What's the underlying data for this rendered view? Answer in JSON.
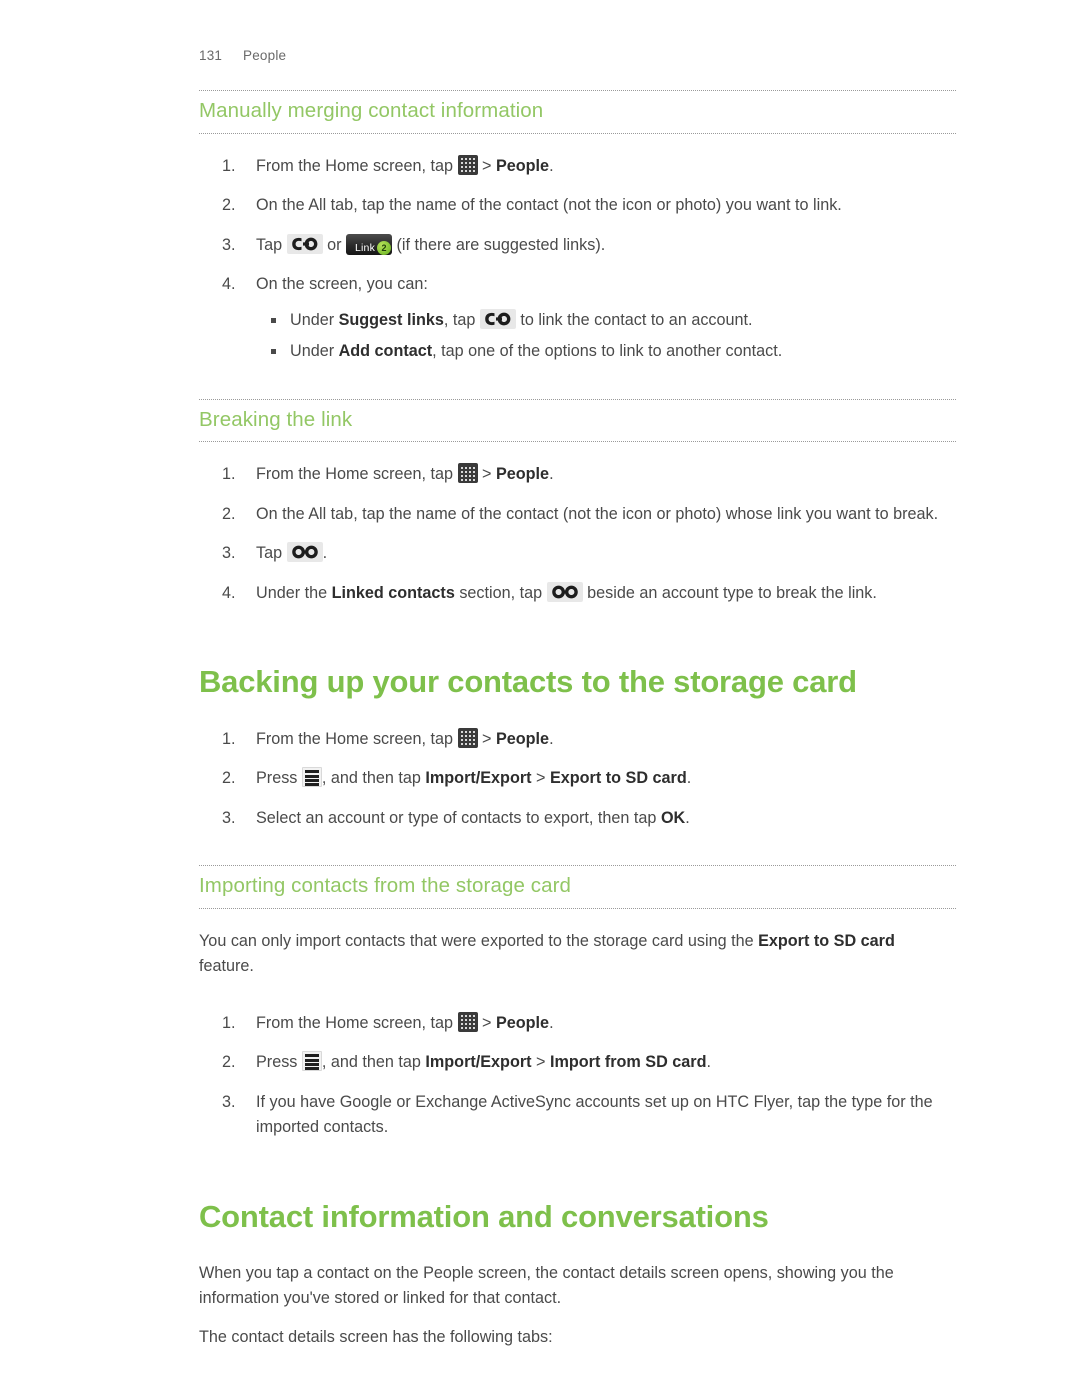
{
  "header": {
    "page_number": "131",
    "section": "People"
  },
  "colors": {
    "heading_h1": "#7ec04b",
    "heading_h2": "#93c765",
    "body_text": "#4a4a4a",
    "rule": "#9a9a9a",
    "badge_green": "#7cbf2f"
  },
  "sections": [
    {
      "id": "manually-merging",
      "level": "h2",
      "title": "Manually merging contact information",
      "steps": [
        {
          "parts": [
            {
              "t": "text",
              "v": "From the Home screen, tap "
            },
            {
              "t": "icon",
              "v": "apps-grid-icon"
            },
            {
              "t": "text",
              "v": " > "
            },
            {
              "t": "bold",
              "v": "People"
            },
            {
              "t": "text",
              "v": "."
            }
          ]
        },
        {
          "parts": [
            {
              "t": "text",
              "v": "On the All tab, tap the name of the contact (not the icon or photo) you want to link."
            }
          ]
        },
        {
          "parts": [
            {
              "t": "text",
              "v": "Tap "
            },
            {
              "t": "icon",
              "v": "link-chain-icon"
            },
            {
              "t": "text",
              "v": " or "
            },
            {
              "t": "icon",
              "v": "link-button-badge-icon"
            },
            {
              "t": "text",
              "v": " (if there are suggested links)."
            }
          ]
        },
        {
          "parts": [
            {
              "t": "text",
              "v": "On the screen, you can:"
            }
          ],
          "bullets": [
            [
              {
                "t": "text",
                "v": "Under "
              },
              {
                "t": "bold",
                "v": "Suggest links"
              },
              {
                "t": "text",
                "v": ", tap "
              },
              {
                "t": "icon",
                "v": "link-chain-icon"
              },
              {
                "t": "text",
                "v": " to link the contact to an account."
              }
            ],
            [
              {
                "t": "text",
                "v": "Under "
              },
              {
                "t": "bold",
                "v": "Add contact"
              },
              {
                "t": "text",
                "v": ", tap one of the options to link to another contact."
              }
            ]
          ]
        }
      ]
    },
    {
      "id": "breaking-the-link",
      "level": "h2",
      "title": "Breaking the link",
      "steps": [
        {
          "parts": [
            {
              "t": "text",
              "v": "From the Home screen, tap "
            },
            {
              "t": "icon",
              "v": "apps-grid-icon"
            },
            {
              "t": "text",
              "v": " > "
            },
            {
              "t": "bold",
              "v": "People"
            },
            {
              "t": "text",
              "v": "."
            }
          ]
        },
        {
          "parts": [
            {
              "t": "text",
              "v": "On the All tab, tap the name of the contact (not the icon or photo) whose link you want to break."
            }
          ]
        },
        {
          "parts": [
            {
              "t": "text",
              "v": "Tap "
            },
            {
              "t": "icon",
              "v": "broken-link-icon"
            },
            {
              "t": "text",
              "v": "."
            }
          ]
        },
        {
          "parts": [
            {
              "t": "text",
              "v": "Under the "
            },
            {
              "t": "bold",
              "v": "Linked contacts"
            },
            {
              "t": "text",
              "v": " section, tap "
            },
            {
              "t": "icon",
              "v": "broken-link-icon"
            },
            {
              "t": "text",
              "v": " beside an account type to break the link."
            }
          ]
        }
      ]
    },
    {
      "id": "backing-up",
      "level": "h1",
      "title": "Backing up your contacts to the storage card",
      "steps": [
        {
          "parts": [
            {
              "t": "text",
              "v": "From the Home screen, tap "
            },
            {
              "t": "icon",
              "v": "apps-grid-icon"
            },
            {
              "t": "text",
              "v": " > "
            },
            {
              "t": "bold",
              "v": "People"
            },
            {
              "t": "text",
              "v": "."
            }
          ]
        },
        {
          "parts": [
            {
              "t": "text",
              "v": "Press "
            },
            {
              "t": "icon",
              "v": "menu-icon"
            },
            {
              "t": "text",
              "v": ", and then tap "
            },
            {
              "t": "bold",
              "v": "Import/Export"
            },
            {
              "t": "text",
              "v": " > "
            },
            {
              "t": "bold",
              "v": "Export to SD card"
            },
            {
              "t": "text",
              "v": "."
            }
          ]
        },
        {
          "parts": [
            {
              "t": "text",
              "v": "Select an account or type of contacts to export, then tap "
            },
            {
              "t": "bold",
              "v": "OK"
            },
            {
              "t": "text",
              "v": "."
            }
          ]
        }
      ]
    },
    {
      "id": "importing",
      "level": "h2",
      "title": "Importing contacts from the storage card",
      "intro": [
        {
          "t": "text",
          "v": "You can only import contacts that were exported to the storage card using the "
        },
        {
          "t": "bold",
          "v": "Export to SD card"
        },
        {
          "t": "text",
          "v": " feature."
        }
      ],
      "steps": [
        {
          "parts": [
            {
              "t": "text",
              "v": "From the Home screen, tap "
            },
            {
              "t": "icon",
              "v": "apps-grid-icon"
            },
            {
              "t": "text",
              "v": " > "
            },
            {
              "t": "bold",
              "v": "People"
            },
            {
              "t": "text",
              "v": "."
            }
          ]
        },
        {
          "parts": [
            {
              "t": "text",
              "v": "Press "
            },
            {
              "t": "icon",
              "v": "menu-icon"
            },
            {
              "t": "text",
              "v": ", and then tap "
            },
            {
              "t": "bold",
              "v": "Import/Export"
            },
            {
              "t": "text",
              "v": " > "
            },
            {
              "t": "bold",
              "v": "Import from SD card"
            },
            {
              "t": "text",
              "v": "."
            }
          ]
        },
        {
          "parts": [
            {
              "t": "text",
              "v": "If you have Google or Exchange ActiveSync accounts set up on HTC Flyer, tap the type for the imported contacts."
            }
          ]
        }
      ]
    },
    {
      "id": "contact-info",
      "level": "h1",
      "title": "Contact information and conversations",
      "paragraphs": [
        [
          {
            "t": "text",
            "v": "When you tap a contact on the People screen, the contact details screen opens, showing you the information you've stored or linked for that contact."
          }
        ],
        [
          {
            "t": "text",
            "v": "The contact details screen has the following tabs:"
          }
        ]
      ]
    }
  ],
  "icons": {
    "link-button-badge-icon": {
      "label": "Link",
      "badge": "2"
    }
  }
}
